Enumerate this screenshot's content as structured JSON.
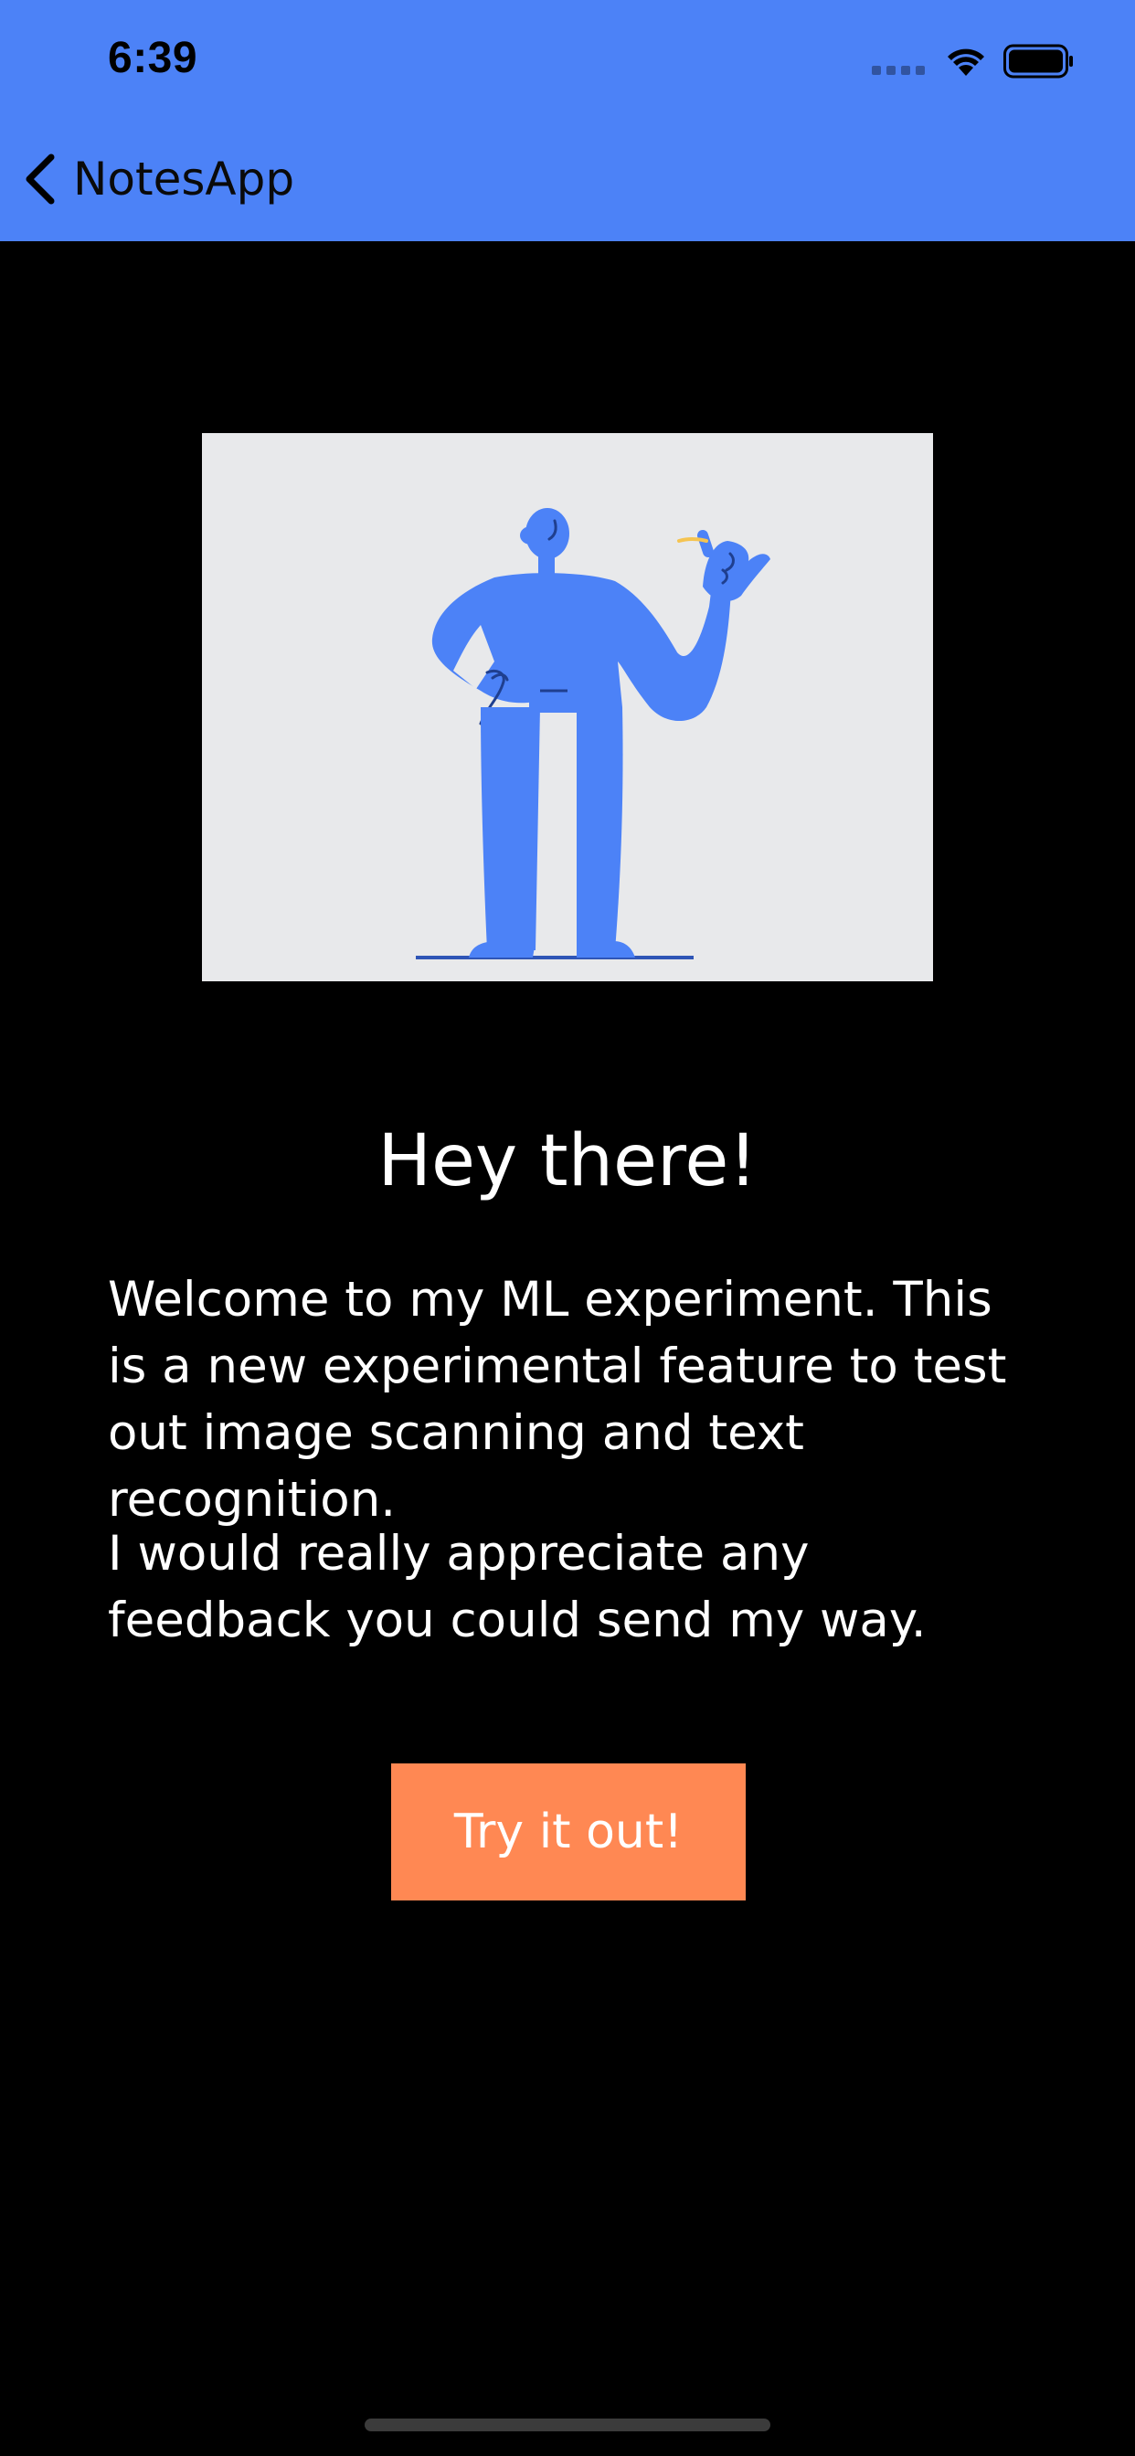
{
  "status_bar": {
    "time": "6:39",
    "icons": [
      "cellular-signal-icon",
      "wifi-icon",
      "battery-icon"
    ]
  },
  "nav": {
    "back_label": "NotesApp",
    "icon": "chevron-left-icon"
  },
  "illustration": {
    "icon": "waving-person-illustration"
  },
  "main": {
    "title": "Hey there!",
    "paragraph1": "Welcome to my ML experiment. This is a new experimental feature to test out image scanning and text recognition.",
    "paragraph2": "I would really appreciate any feedback you could send my way.",
    "cta_label": "Try it out!"
  },
  "colors": {
    "header_bg": "#4c82f7",
    "background": "#000000",
    "cta_bg": "#ff8853",
    "illustration_bg": "#e8e9eb",
    "figure": "#4c82f7"
  }
}
